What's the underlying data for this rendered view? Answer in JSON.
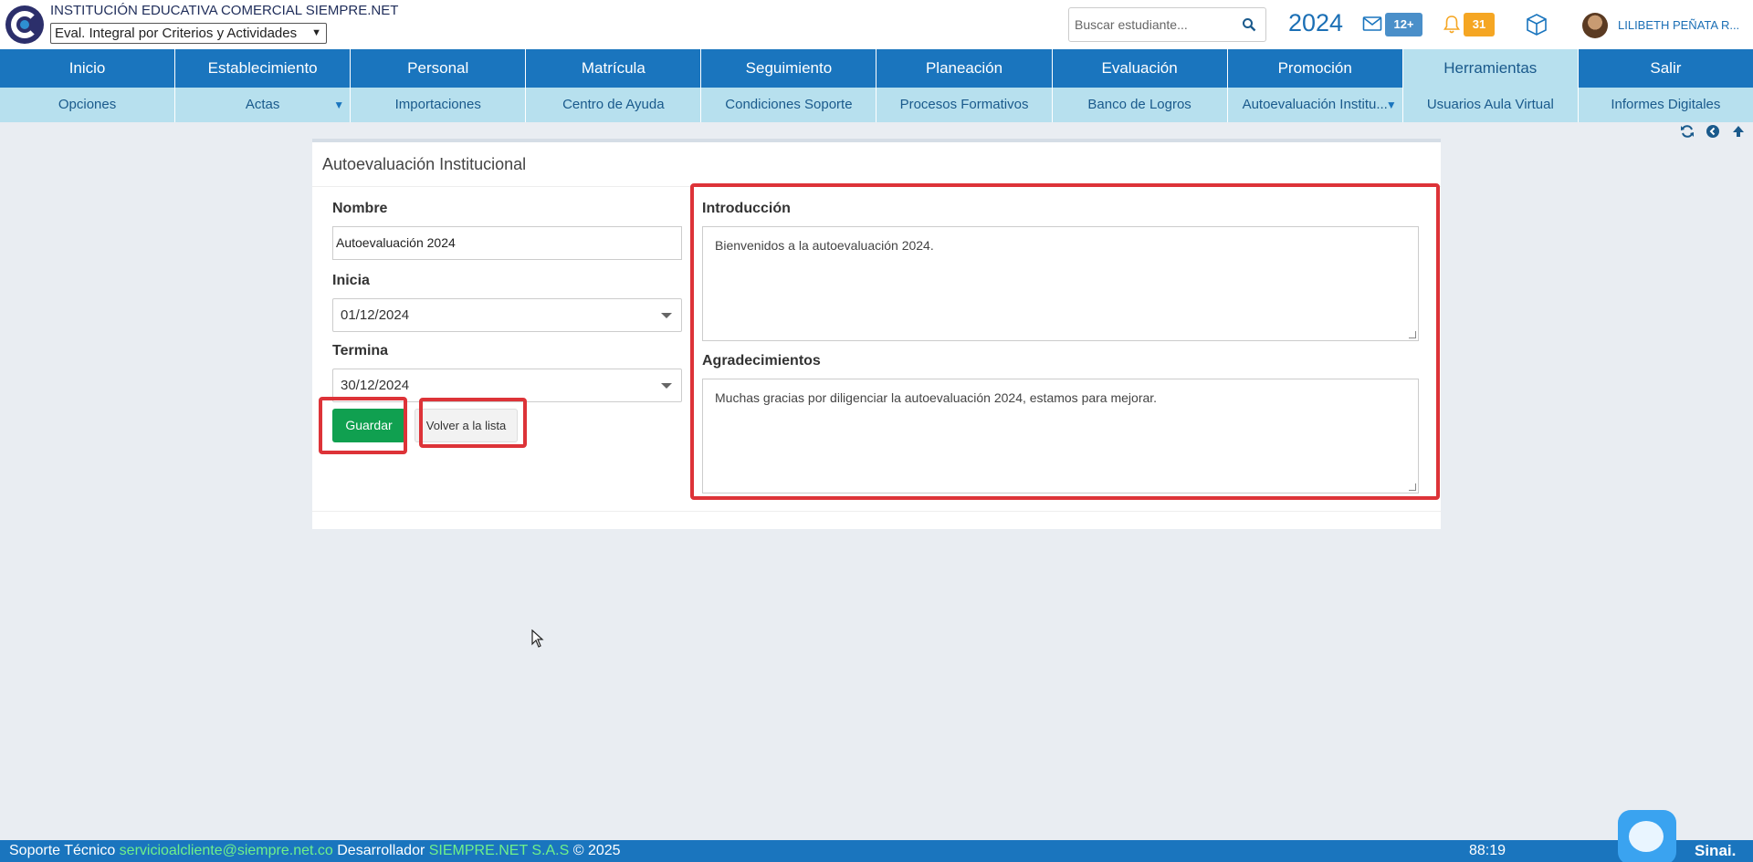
{
  "header": {
    "institution": "INSTITUCIÓN EDUCATIVA COMERCIAL SIEMPRE.NET",
    "eval_select": "Eval. Integral por Criterios y Actividades",
    "search_placeholder": "Buscar estudiante...",
    "year": "2024",
    "messages_badge": "12+",
    "notifications_badge": "31",
    "username": "LILIBETH PEÑATA R..."
  },
  "nav": {
    "main": [
      {
        "label": "Inicio"
      },
      {
        "label": "Establecimiento"
      },
      {
        "label": "Personal"
      },
      {
        "label": "Matrícula"
      },
      {
        "label": "Seguimiento"
      },
      {
        "label": "Planeación"
      },
      {
        "label": "Evaluación"
      },
      {
        "label": "Promoción"
      },
      {
        "label": "Herramientas",
        "active": true
      },
      {
        "label": "Salir"
      }
    ],
    "sub": [
      {
        "label": "Opciones"
      },
      {
        "label": "Actas",
        "dropdown": true
      },
      {
        "label": "Importaciones"
      },
      {
        "label": "Centro de Ayuda"
      },
      {
        "label": "Condiciones Soporte"
      },
      {
        "label": "Procesos Formativos"
      },
      {
        "label": "Banco de Logros"
      },
      {
        "label": "Autoevaluación Institu...",
        "dropdown": true
      },
      {
        "label": "Usuarios Aula Virtual"
      },
      {
        "label": "Informes Digitales"
      }
    ]
  },
  "panel": {
    "title": "Autoevaluación Institucional",
    "nombre_label": "Nombre",
    "nombre_value": "Autoevaluación 2024",
    "inicia_label": "Inicia",
    "inicia_value": "01/12/2024",
    "termina_label": "Termina",
    "termina_value": "30/12/2024",
    "save_button": "Guardar",
    "back_button": "Volver a la lista",
    "intro_label": "Introducción",
    "intro_text": "Bienvenidos a la autoevaluación 2024.",
    "thanks_label": "Agradecimientos",
    "thanks_text": "Muchas gracias por diligenciar la autoevaluación 2024, estamos para mejorar."
  },
  "footer": {
    "support_label": "Soporte Técnico",
    "support_email": "servicioalcliente@siempre.net.co",
    "developer_label": "Desarrollador",
    "developer_name": "SIEMPRE.NET S.A.S",
    "copyright": "© 2025",
    "timer": "88:19",
    "brand": "Sinai."
  },
  "colors": {
    "primary": "#1a75be",
    "subnav": "#b7e0ee",
    "save": "#10a050",
    "highlight": "#dd3338"
  }
}
